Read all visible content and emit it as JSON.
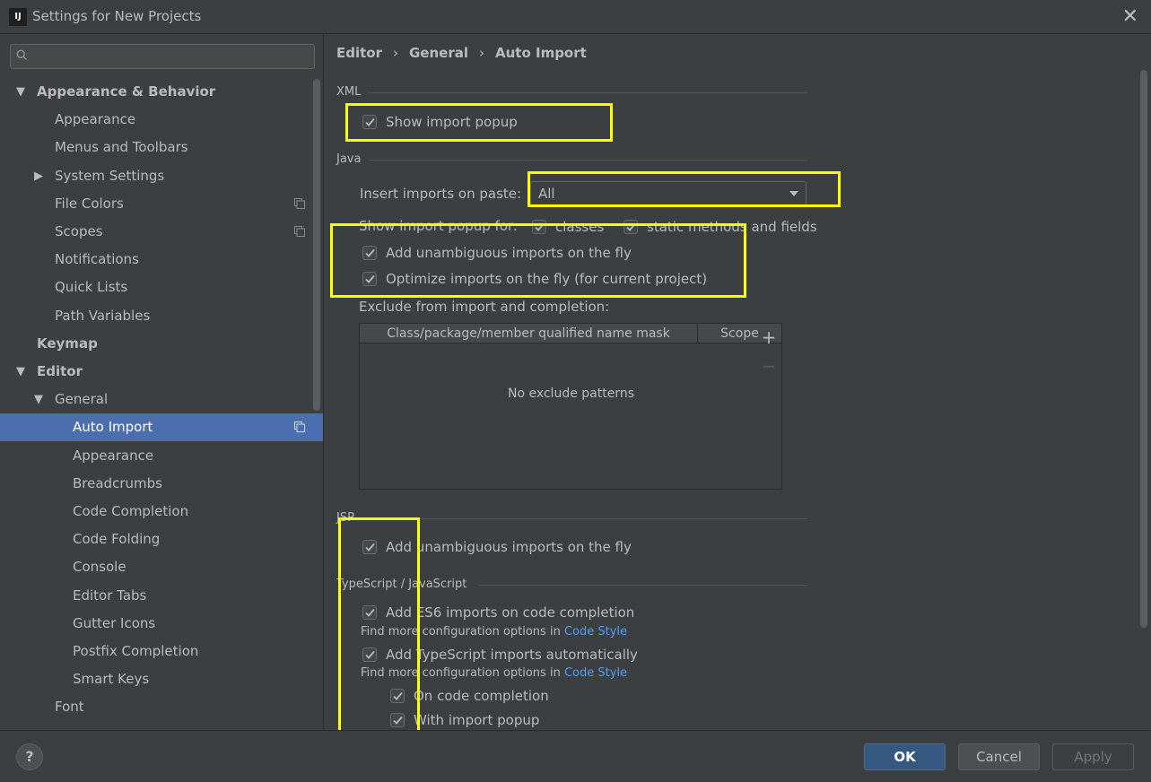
{
  "window": {
    "title": "Settings for New Projects"
  },
  "search": {
    "placeholder": ""
  },
  "tree": [
    {
      "label": "Appearance & Behavior",
      "level": 0,
      "bold": true,
      "arrow": "down"
    },
    {
      "label": "Appearance",
      "level": 1
    },
    {
      "label": "Menus and Toolbars",
      "level": 1
    },
    {
      "label": "System Settings",
      "level": 1,
      "arrow": "right"
    },
    {
      "label": "File Colors",
      "level": 1,
      "copy_icon": true
    },
    {
      "label": "Scopes",
      "level": 1,
      "copy_icon": true
    },
    {
      "label": "Notifications",
      "level": 1
    },
    {
      "label": "Quick Lists",
      "level": 1
    },
    {
      "label": "Path Variables",
      "level": 1
    },
    {
      "label": "Keymap",
      "level": 0,
      "bold": true
    },
    {
      "label": "Editor",
      "level": 0,
      "bold": true,
      "arrow": "down"
    },
    {
      "label": "General",
      "level": 1,
      "arrow": "down"
    },
    {
      "label": "Auto Import",
      "level": 2,
      "selected": true,
      "copy_icon": true
    },
    {
      "label": "Appearance",
      "level": 2
    },
    {
      "label": "Breadcrumbs",
      "level": 2
    },
    {
      "label": "Code Completion",
      "level": 2
    },
    {
      "label": "Code Folding",
      "level": 2
    },
    {
      "label": "Console",
      "level": 2
    },
    {
      "label": "Editor Tabs",
      "level": 2
    },
    {
      "label": "Gutter Icons",
      "level": 2
    },
    {
      "label": "Postfix Completion",
      "level": 2
    },
    {
      "label": "Smart Keys",
      "level": 2
    },
    {
      "label": "Font",
      "level": 1
    }
  ],
  "breadcrumb": {
    "items": [
      "Editor",
      "General",
      "Auto Import"
    ],
    "separator": "›"
  },
  "xml": {
    "title": "XML",
    "show_import_popup": {
      "label": "Show import popup",
      "checked": true
    }
  },
  "java": {
    "title": "Java",
    "insert_imports_label": "Insert imports on paste:",
    "insert_imports_value": "All",
    "show_popup_for_label": "Show import popup for:",
    "classes": {
      "label": "classes",
      "checked": true
    },
    "static_methods": {
      "label": "static methods and fields",
      "checked": true
    },
    "add_unambiguous": {
      "label": "Add unambiguous imports on the fly",
      "checked": true
    },
    "optimize_imports": {
      "label": "Optimize imports on the fly (for current project)",
      "checked": true
    },
    "exclude_label": "Exclude from import and completion:",
    "table": {
      "columns": [
        "Class/package/member qualified name mask",
        "Scope"
      ],
      "empty_text": "No exclude patterns"
    }
  },
  "jsp": {
    "title": "JSP",
    "add_unambiguous": {
      "label": "Add unambiguous imports on the fly",
      "checked": true
    }
  },
  "ts": {
    "title": "TypeScript / JavaScript",
    "add_es6": {
      "label": "Add ES6 imports on code completion",
      "checked": true
    },
    "hint_prefix": "Find more configuration options in",
    "hint_link": "Code Style",
    "add_ts": {
      "label": "Add TypeScript imports automatically",
      "checked": true
    },
    "on_completion": {
      "label": "On code completion",
      "checked": true
    },
    "with_popup": {
      "label": "With import popup",
      "checked": true
    }
  },
  "footer": {
    "help": "?",
    "ok": "OK",
    "cancel": "Cancel",
    "apply": "Apply"
  },
  "colors": {
    "background": "#3c3f41",
    "selection": "#4b6eaf",
    "highlight": "#ffff00",
    "link": "#589df6",
    "ok_button": "#365880"
  }
}
